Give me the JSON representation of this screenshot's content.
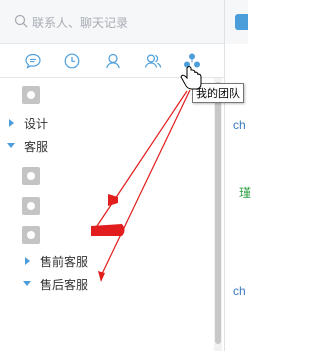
{
  "search": {
    "placeholder": "联系人、聊天记录"
  },
  "tabs": [
    {
      "name": "messages",
      "icon": "chat-bubble-icon"
    },
    {
      "name": "recent",
      "icon": "clock-icon"
    },
    {
      "name": "contacts",
      "icon": "person-icon"
    },
    {
      "name": "groups",
      "icon": "group-icon"
    },
    {
      "name": "my-team",
      "icon": "team-icon",
      "active": true
    }
  ],
  "tooltip": {
    "text": "我的团队"
  },
  "tree": {
    "groups": [
      {
        "label": "设计",
        "expanded": false
      },
      {
        "label": "客服",
        "expanded": true,
        "subgroups": [
          {
            "label": "售前客服",
            "expanded": false
          },
          {
            "label": "售后客服",
            "expanded": true
          }
        ]
      }
    ]
  },
  "right_panel": {
    "snippets": [
      "ch",
      "瑾",
      "ch"
    ]
  },
  "colors": {
    "accent": "#4c9edb",
    "annotation": "#e21d1d",
    "snippet_green": "#3aa34a",
    "snippet_blue": "#3a7bbf"
  }
}
